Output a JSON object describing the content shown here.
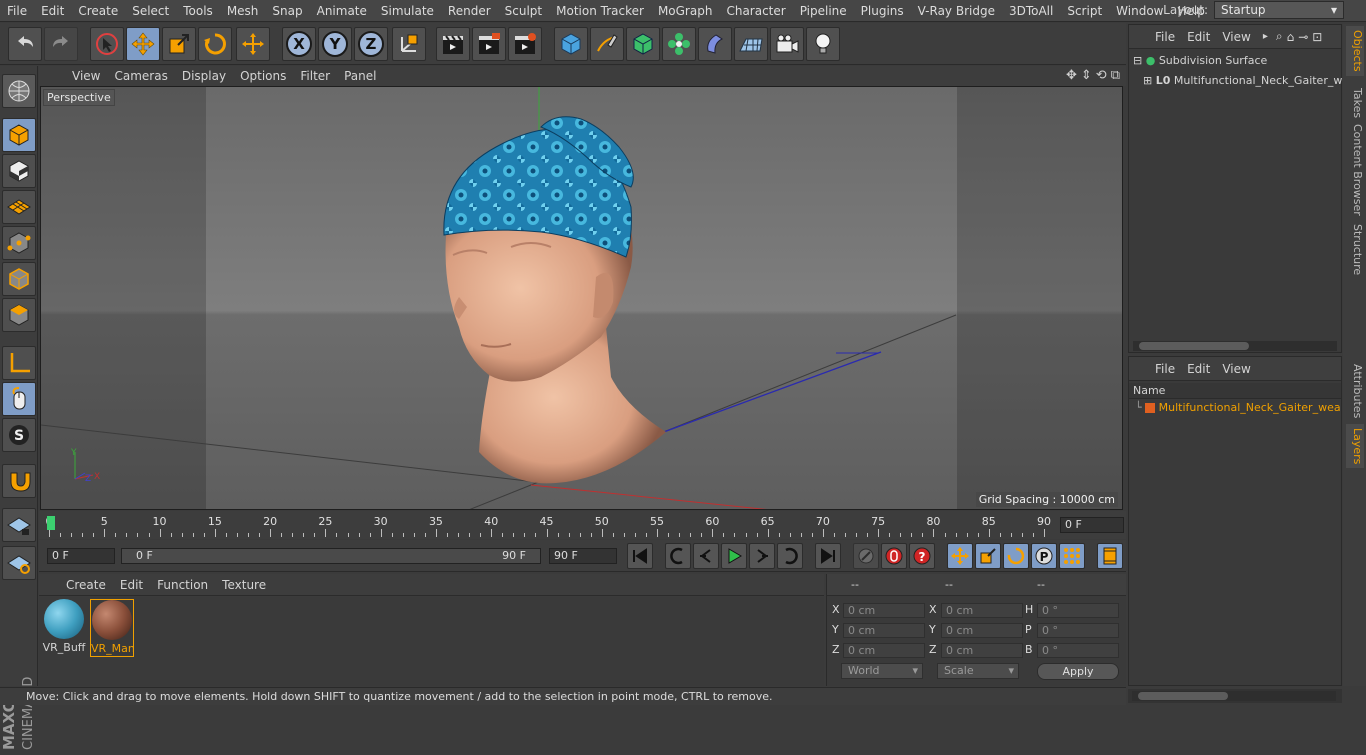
{
  "menubar": {
    "items": [
      "File",
      "Edit",
      "Create",
      "Select",
      "Tools",
      "Mesh",
      "Snap",
      "Animate",
      "Simulate",
      "Render",
      "Sculpt",
      "Motion Tracker",
      "MoGraph",
      "Character",
      "Pipeline",
      "Plugins",
      "V-Ray Bridge",
      "3DToAll",
      "Script",
      "Window",
      "Help"
    ],
    "layout_label": "Layout:",
    "layout_value": "Startup"
  },
  "toolbar": {
    "axis_x": "X",
    "axis_y": "Y",
    "axis_z": "Z"
  },
  "viewport": {
    "menu": [
      "View",
      "Cameras",
      "Display",
      "Options",
      "Filter",
      "Panel"
    ],
    "camera_label": "Perspective",
    "grid_spacing": "Grid Spacing : 10000 cm",
    "axis_y": "Y",
    "axis_z": "Z",
    "axis_x": "X"
  },
  "timeline": {
    "ticks": [
      "0",
      "5",
      "10",
      "15",
      "20",
      "25",
      "30",
      "35",
      "40",
      "45",
      "50",
      "55",
      "60",
      "65",
      "70",
      "75",
      "80",
      "85",
      "90"
    ],
    "current_frame": "0 F"
  },
  "transport": {
    "start_field": "0 F",
    "range_start": "0 F",
    "range_end": "90 F",
    "end_field": "90 F"
  },
  "materials": {
    "menu": [
      "Create",
      "Edit",
      "Function",
      "Texture"
    ],
    "items": [
      {
        "name": "VR_Buff",
        "color": "#3f9fc0"
      },
      {
        "name": "VR_Man",
        "color": "#8a4f3a"
      }
    ]
  },
  "coordinates": {
    "headers": [
      "--",
      "--",
      "--"
    ],
    "rows": [
      {
        "l1": "X",
        "v1": "0 cm",
        "l2": "X",
        "v2": "0 cm",
        "l3": "H",
        "v3": "0 °"
      },
      {
        "l1": "Y",
        "v1": "0 cm",
        "l2": "Y",
        "v2": "0 cm",
        "l3": "P",
        "v3": "0 °"
      },
      {
        "l1": "Z",
        "v1": "0 cm",
        "l2": "Z",
        "v2": "0 cm",
        "l3": "B",
        "v3": "0 °"
      }
    ],
    "mode1": "World",
    "mode2": "Scale",
    "apply": "Apply"
  },
  "status": "Move: Click and drag to move elements. Hold down SHIFT to quantize movement / add to the selection in point mode, CTRL to remove.",
  "objects": {
    "menu": [
      "File",
      "Edit",
      "View"
    ],
    "tree": [
      "Subdivision Surface",
      "Multifunctional_Neck_Gaiter_we"
    ]
  },
  "layers": {
    "menu": [
      "File",
      "Edit",
      "View"
    ],
    "column": "Name",
    "item": "Multifunctional_Neck_Gaiter_wea"
  },
  "right_tabs": [
    "Objects",
    "Takes",
    "Content Browser",
    "Structure",
    "Attributes",
    "Layers"
  ],
  "colors": {
    "accent_orange": "#f0a000",
    "selected_blue": "#7f9dc7"
  }
}
